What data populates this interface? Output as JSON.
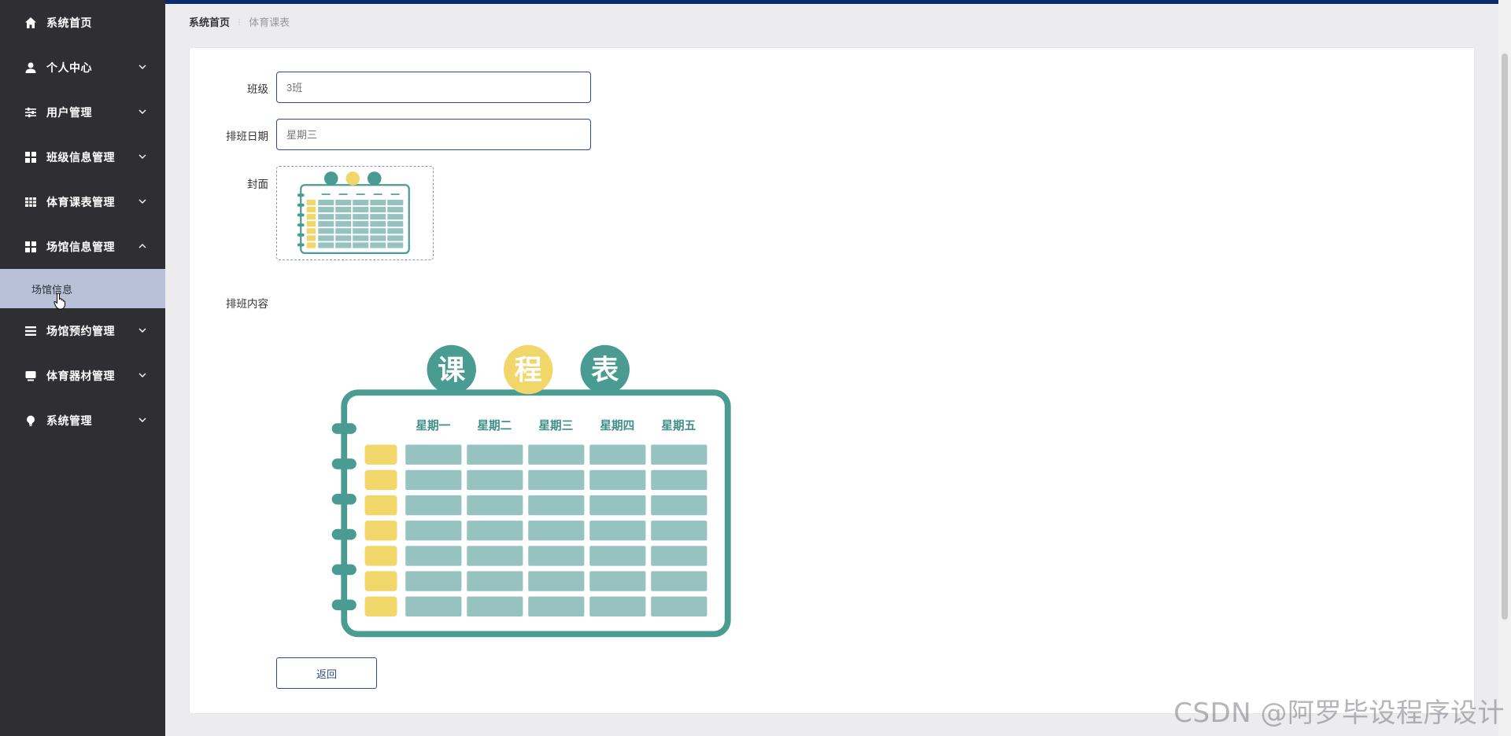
{
  "sidebar": {
    "items": [
      {
        "label": "系统首页",
        "icon": "home-icon",
        "has_chevron": false
      },
      {
        "label": "个人中心",
        "icon": "user-icon",
        "has_chevron": true
      },
      {
        "label": "用户管理",
        "icon": "sliders-icon",
        "has_chevron": true
      },
      {
        "label": "班级信息管理",
        "icon": "grid-icon",
        "has_chevron": true
      },
      {
        "label": "体育课表管理",
        "icon": "table-icon",
        "has_chevron": true
      },
      {
        "label": "场馆信息管理",
        "icon": "grid-icon",
        "has_chevron": true,
        "expanded": true
      },
      {
        "label": "场馆预约管理",
        "icon": "list-icon",
        "has_chevron": true
      },
      {
        "label": "体育器材管理",
        "icon": "monitor-icon",
        "has_chevron": true
      },
      {
        "label": "系统管理",
        "icon": "bulb-icon",
        "has_chevron": true
      }
    ],
    "subitem": {
      "label": "场馆信息"
    }
  },
  "breadcrumb": {
    "home": "系统首页",
    "current": "体育课表"
  },
  "form": {
    "class": {
      "label": "班级",
      "placeholder": "3班"
    },
    "date": {
      "label": "排班日期",
      "placeholder": "星期三"
    },
    "cover": {
      "label": "封面"
    },
    "content": {
      "label": "排班内容"
    }
  },
  "timetable": {
    "title_chars": [
      "课",
      "程",
      "表"
    ],
    "days": [
      "星期一",
      "星期二",
      "星期三",
      "星期四",
      "星期五"
    ],
    "rows": 7
  },
  "buttons": {
    "back": "返回"
  },
  "watermark": "CSDN @阿罗毕设程序设计",
  "colors": {
    "sidebar_bg": "#2f2f33",
    "accent": "#2d4a8a",
    "teal": "#4a9b92",
    "cell": "#96c3bf",
    "yellow": "#f1d66a"
  }
}
